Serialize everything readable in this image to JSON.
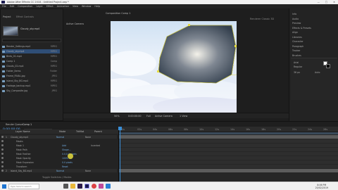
{
  "window": {
    "title": "Adobe After Effects CC 2018 - Untitled Project.aep *"
  },
  "menu": [
    "File",
    "Edit",
    "Composition",
    "Layer",
    "Effect",
    "Animation",
    "View",
    "Window",
    "Help"
  ],
  "project_panel": {
    "tab": "Project",
    "header": "Effect Controls",
    "selected_info": "Cloudy_sky.mp4",
    "items": [
      {
        "name": "Render_Settings.mp4",
        "type": "MPEG"
      },
      {
        "name": "Cloudy_sky.mp4",
        "type": "MPEG"
      },
      {
        "name": "Birds_01.mp4",
        "type": "MPEG"
      },
      {
        "name": "Comp 1",
        "type": "Comp"
      },
      {
        "name": "Clouds_02.mp4",
        "type": "MPEG"
      },
      {
        "name": "Folder_Items",
        "type": "Folder"
      },
      {
        "name": "Frame_FINAL.jpg",
        "type": "JPEG"
      },
      {
        "name": "Island_Sky_BG.mp4",
        "type": "MPEG"
      },
      {
        "name": "Footage_backup.mp4",
        "type": "MPEG"
      },
      {
        "name": "Sky_Composite.jpg",
        "type": "JPEG"
      }
    ]
  },
  "composition_panel": {
    "tab": "Composition Comp 1",
    "viewer_label": "Active Camera",
    "footer": {
      "zoom": "50%",
      "time": "0:00:00:00",
      "resolution": "Full",
      "camera": "Active Camera",
      "views": "1 View"
    },
    "header_right": "Renderer Classic 3D"
  },
  "right_panel": {
    "items": [
      "Info",
      "Audio",
      "Preview",
      "Effects & Presets",
      "Align",
      "Libraries",
      "Character",
      "Paragraph",
      "Tracker",
      "Brushes"
    ],
    "character": {
      "font": "Arial",
      "style": "Regular",
      "size": "36 px",
      "leading": "Auto"
    }
  },
  "timeline": {
    "tab": "Comp 1",
    "tab2": "Render Queue",
    "timecode": "0;00;00;00",
    "ruler_ticks": [
      "0s",
      "02s",
      "04s",
      "06s",
      "08s",
      "10s",
      "12s",
      "14s",
      "16s",
      "18s",
      "20s",
      "22s",
      "24s",
      "26s"
    ],
    "columns": [
      "Layer Name",
      "Mode",
      "TrkMat",
      "Parent"
    ],
    "layers": [
      {
        "num": "1",
        "name": "Cloudy_sky.mp4",
        "mode": "Normal",
        "parent": "None"
      },
      {
        "num": "",
        "name": "Masks",
        "mode": "",
        "parent": ""
      },
      {
        "num": "",
        "name": "Mask 1",
        "mode": "Add",
        "parent": "Inverted"
      },
      {
        "num": "",
        "name": "Mask Path",
        "mode": "Shape...",
        "parent": ""
      },
      {
        "num": "",
        "name": "Mask Feather",
        "mode": "0.0,0.0 pixels",
        "parent": ""
      },
      {
        "num": "",
        "name": "Mask Opacity",
        "mode": "100%",
        "parent": ""
      },
      {
        "num": "",
        "name": "Mask Expansion",
        "mode": "0.0 pixels",
        "parent": ""
      },
      {
        "num": "",
        "name": "Transform",
        "mode": "Reset",
        "parent": ""
      },
      {
        "num": "2",
        "name": "Island_Sky_BG.mp4",
        "mode": "Normal",
        "parent": "None"
      }
    ],
    "footer": "Toggle Switches / Modes"
  },
  "taskbar": {
    "time": "8:06 PM",
    "date": "20/02/2019",
    "search_placeholder": "Type here to search"
  },
  "colors": {
    "selection_blue": "#2f4e76",
    "mask_yellow": "#e6dd40",
    "playhead_blue": "#3a8fd8",
    "layer_bar_gray": "#5c5c5c",
    "taskbar_bg": "#f0f0f0"
  }
}
